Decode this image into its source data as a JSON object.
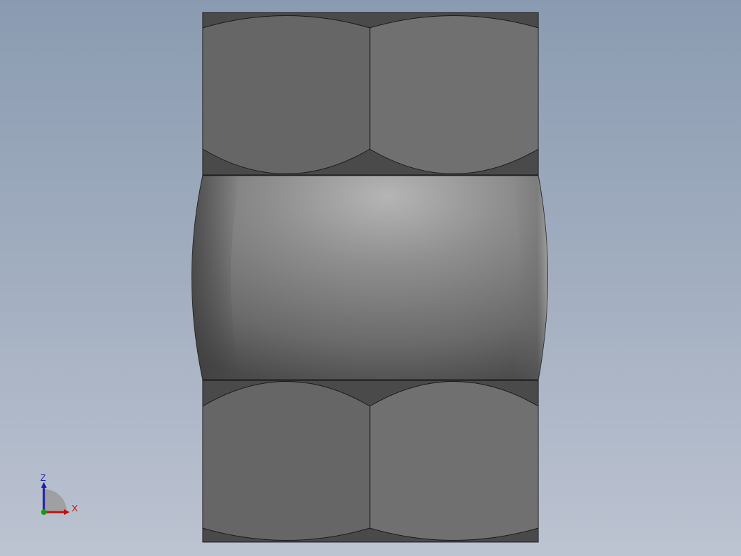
{
  "viewport": {
    "background_top": "#8a9bb1",
    "background_bottom": "#bcc3d1"
  },
  "model": {
    "part": "hex-coupling-nut",
    "nut_face_left_color": "#666666",
    "nut_face_right_color": "#707070",
    "nut_dark_color": "#4a4a4a",
    "barrel_highlight_color": "#b5b5b5",
    "barrel_shadow_color": "#3c3c3c",
    "edge_color": "#1a1a1a"
  },
  "triad": {
    "z_label": "Z",
    "x_label": "X",
    "z_color": "#1a1aa8",
    "x_color": "#c01010",
    "y_color": "#10a010"
  }
}
